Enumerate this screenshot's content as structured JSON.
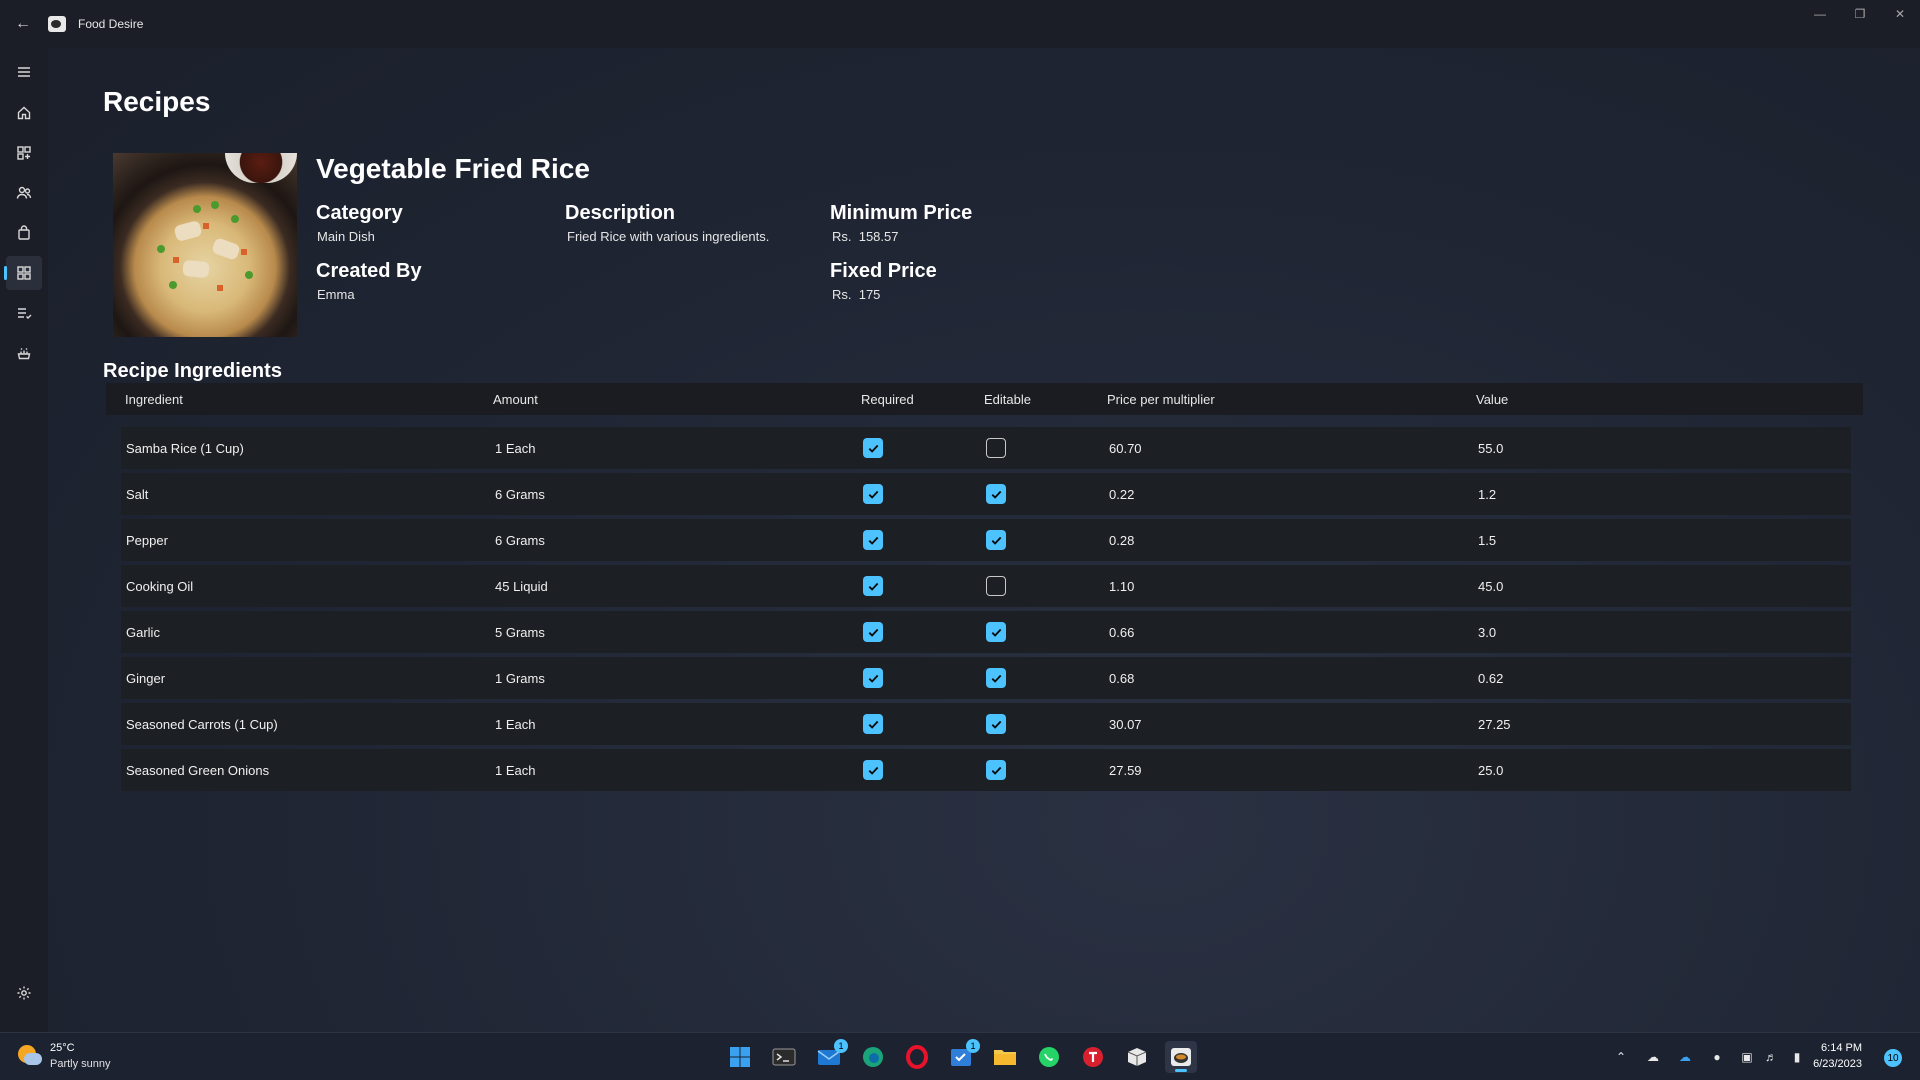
{
  "window": {
    "app_title": "Food Desire",
    "controls": [
      "minimize-icon",
      "restore-icon",
      "close-icon"
    ]
  },
  "nav": {
    "items": [
      {
        "name": "menu",
        "icon": "hamburger-icon"
      },
      {
        "name": "home",
        "icon": "home-icon"
      },
      {
        "name": "dashboard",
        "icon": "grid-add-icon"
      },
      {
        "name": "people",
        "icon": "people-icon"
      },
      {
        "name": "products",
        "icon": "bag-icon"
      },
      {
        "name": "recipes",
        "icon": "apps-icon",
        "selected": true
      },
      {
        "name": "tasks",
        "icon": "list-check-icon"
      },
      {
        "name": "food",
        "icon": "food-icon"
      }
    ],
    "settings_icon": "gear-icon"
  },
  "page": {
    "title": "Recipes"
  },
  "recipe": {
    "name": "Vegetable Fried Rice",
    "category_label": "Category",
    "category": "Main Dish",
    "description_label": "Description",
    "description": "Fried Rice with various ingredients.",
    "min_price_label": "Minimum Price",
    "min_price": "Rs.  158.57",
    "created_by_label": "Created By",
    "created_by": "Emma",
    "fixed_price_label": "Fixed Price",
    "fixed_price": "Rs.  175"
  },
  "ingredients": {
    "title": "Recipe Ingredients",
    "columns": [
      "Ingredient",
      "Amount",
      "Required",
      "Editable",
      "Price per multiplier",
      "Value"
    ],
    "rows": [
      {
        "ingredient": "Samba Rice (1 Cup)",
        "amount": "1 Each",
        "required": true,
        "editable": false,
        "price": "60.70",
        "value": "55.0"
      },
      {
        "ingredient": "Salt",
        "amount": "6 Grams",
        "required": true,
        "editable": true,
        "price": "0.22",
        "value": "1.2"
      },
      {
        "ingredient": "Pepper",
        "amount": "6 Grams",
        "required": true,
        "editable": true,
        "price": "0.28",
        "value": "1.5"
      },
      {
        "ingredient": "Cooking Oil",
        "amount": "45 Liquid",
        "required": true,
        "editable": false,
        "price": "1.10",
        "value": "45.0"
      },
      {
        "ingredient": "Garlic",
        "amount": "5 Grams",
        "required": true,
        "editable": true,
        "price": "0.66",
        "value": "3.0"
      },
      {
        "ingredient": "Ginger",
        "amount": "1 Grams",
        "required": true,
        "editable": true,
        "price": "0.68",
        "value": "0.62"
      },
      {
        "ingredient": "Seasoned Carrots (1 Cup)",
        "amount": "1 Each",
        "required": true,
        "editable": true,
        "price": "30.07",
        "value": "27.25"
      },
      {
        "ingredient": "Seasoned Green Onions",
        "amount": "1 Each",
        "required": true,
        "editable": true,
        "price": "27.59",
        "value": "25.0"
      }
    ]
  },
  "taskbar": {
    "weather_temp": "25°C",
    "weather_condition": "Partly sunny",
    "apps": [
      {
        "name": "start",
        "icon": "windows-logo-icon"
      },
      {
        "name": "terminal",
        "icon": "terminal-icon"
      },
      {
        "name": "mail",
        "icon": "mail-icon",
        "badge": "1"
      },
      {
        "name": "edge-dev",
        "icon": "edge-dev-icon"
      },
      {
        "name": "opera",
        "icon": "opera-icon"
      },
      {
        "name": "todo",
        "icon": "todo-icon",
        "badge": "1"
      },
      {
        "name": "file-explorer",
        "icon": "folder-icon"
      },
      {
        "name": "whatsapp",
        "icon": "whatsapp-icon"
      },
      {
        "name": "t-app",
        "icon": "t-app-icon"
      },
      {
        "name": "package",
        "icon": "box-icon"
      },
      {
        "name": "food-desire",
        "icon": "food-desire-icon",
        "active": true
      }
    ],
    "time": "6:14 PM",
    "date": "6/23/2023",
    "notifications": "10"
  },
  "colors": {
    "accent": "#4cc2ff",
    "background": "#1f2533",
    "row": "#1c1f24",
    "header": "#1a1c22"
  }
}
